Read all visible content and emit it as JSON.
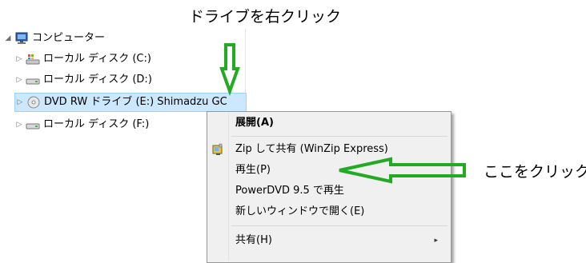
{
  "annotations": {
    "top_caption": "ドライブを右クリック",
    "right_caption": "ここをクリック",
    "arrow_color": "#22aa22"
  },
  "tree": {
    "items": [
      {
        "label": "コンピューター",
        "expander": "◢",
        "icon": "computer-icon"
      },
      {
        "label": "ローカル ディスク (C:)",
        "expander": "▷",
        "icon": "system-drive-icon"
      },
      {
        "label": "ローカル ディスク (D:)",
        "expander": "▷",
        "icon": "hard-drive-icon"
      },
      {
        "label": "DVD RW ドライブ (E:) Shimadzu GC",
        "expander": "▷",
        "icon": "dvd-drive-icon",
        "selected": true
      },
      {
        "label": "ローカル ディスク (F:)",
        "expander": "▷",
        "icon": "hard-drive-icon"
      }
    ]
  },
  "context_menu": {
    "items": [
      {
        "label": "展開(A)",
        "bold": true
      },
      {
        "label": "Zip して共有 (WinZip Express)",
        "icon": "winzip-icon"
      },
      {
        "label": "再生(P)"
      },
      {
        "label": "PowerDVD 9.5 で再生"
      },
      {
        "label": "新しいウィンドウで開く(E)"
      },
      {
        "label": "共有(H)",
        "submenu": "▸"
      }
    ]
  }
}
